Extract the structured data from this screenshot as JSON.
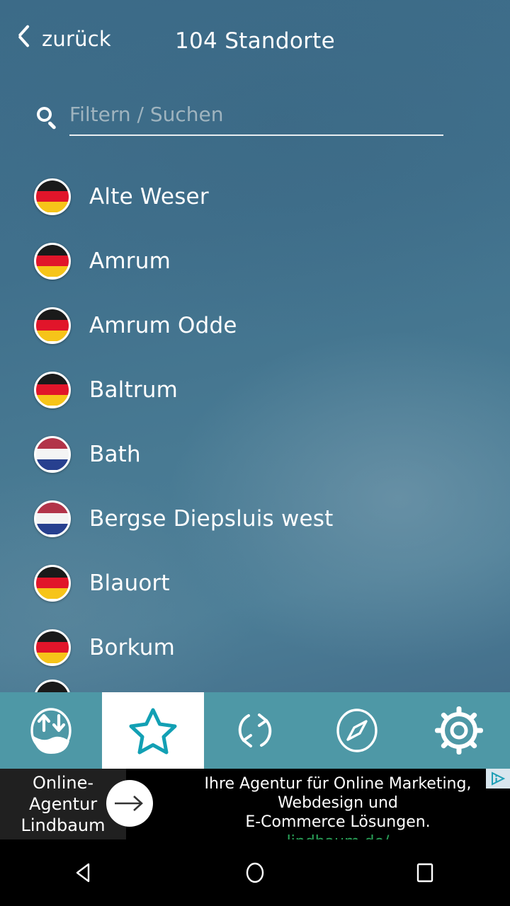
{
  "header": {
    "back_label": "zurück",
    "back_icon": "chevron-left-icon",
    "title": "104 Standorte"
  },
  "search": {
    "icon": "search-icon",
    "placeholder": "Filtern / Suchen",
    "value": ""
  },
  "list": {
    "items": [
      {
        "name": "Alte Weser",
        "flag": "de"
      },
      {
        "name": "Amrum",
        "flag": "de"
      },
      {
        "name": "Amrum Odde",
        "flag": "de"
      },
      {
        "name": "Baltrum",
        "flag": "de"
      },
      {
        "name": "Bath",
        "flag": "nl"
      },
      {
        "name": "Bergse Diepsluis west",
        "flag": "nl"
      },
      {
        "name": "Blauort",
        "flag": "de"
      },
      {
        "name": "Borkum",
        "flag": "de"
      },
      {
        "name": "",
        "flag": "de"
      }
    ]
  },
  "flags": {
    "de": {
      "s1": "#1a1a1a",
      "s2": "#e1152a",
      "s3": "#f6c419"
    },
    "nl": {
      "s1": "#b23449",
      "s2": "#f4f4f4",
      "s3": "#27408f"
    }
  },
  "tabbar": {
    "background": "#4e98a6",
    "active_color": "#12a0b4",
    "items": [
      {
        "icon": "tide-icon",
        "active": false
      },
      {
        "icon": "star-icon",
        "active": true
      },
      {
        "icon": "refresh-icon",
        "active": false
      },
      {
        "icon": "compass-icon",
        "active": false
      },
      {
        "icon": "gear-icon",
        "active": false
      }
    ]
  },
  "ad": {
    "brand_line1": "Online-",
    "brand_line2": "Agentur",
    "brand_line3": "Lindbaum",
    "arrow_icon": "arrow-right-icon",
    "headline_line1": "Ihre Agentur für Online Marketing, Webdesign und",
    "headline_line2": "E-Commerce Lösungen.",
    "url": "lindbaum.de/",
    "url_color": "#2aa55a",
    "adchoices_icon": "adchoices-icon"
  },
  "navbar": {
    "buttons": [
      {
        "icon": "android-back-icon"
      },
      {
        "icon": "android-home-icon"
      },
      {
        "icon": "android-recents-icon"
      }
    ]
  }
}
